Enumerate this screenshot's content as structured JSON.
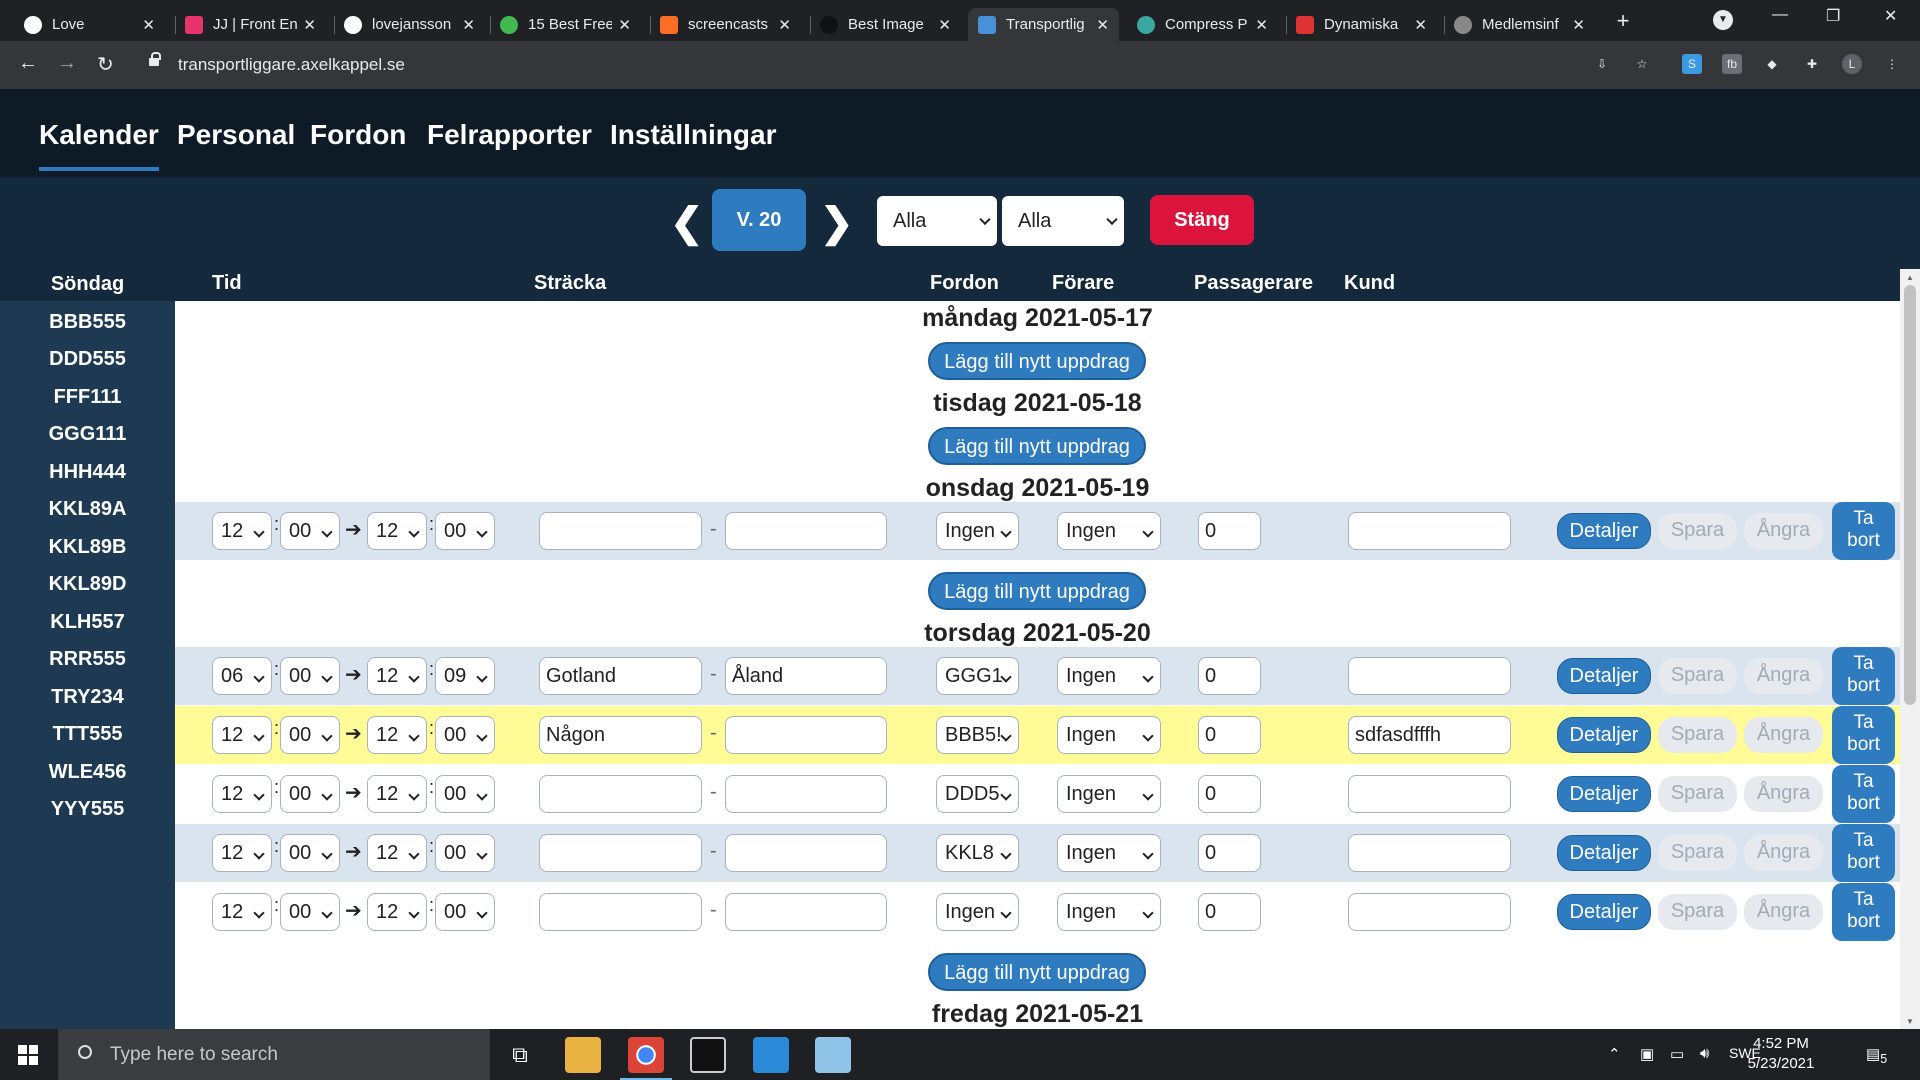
{
  "browser": {
    "tabs": [
      {
        "title": "Love",
        "color": "#ffffff"
      },
      {
        "title": "JJ | Front En",
        "color": "#e8336d"
      },
      {
        "title": "lovejansson",
        "color": "#ffffff"
      },
      {
        "title": "15 Best Free",
        "color": "#3fb950"
      },
      {
        "title": "screencasts",
        "color": "#fc6d26"
      },
      {
        "title": "Best Image",
        "color": "#111111"
      },
      {
        "title": "Transportlig",
        "color": "#4a90d9",
        "active": true
      },
      {
        "title": "Compress P",
        "color": "#3aa8a0"
      },
      {
        "title": "Dynamiska",
        "color": "#d33"
      },
      {
        "title": "Medlemsinf",
        "color": "#888888"
      }
    ],
    "url": "transportliggare.axelkappel.se"
  },
  "nav": {
    "items": [
      "Kalender",
      "Personal",
      "Fordon",
      "Felrapporter",
      "Inställningar"
    ]
  },
  "toolbar": {
    "week": "V. 20",
    "filter1": "Alla",
    "filter2": "Alla",
    "close": "Stäng"
  },
  "sidebar": {
    "title": "Söndag",
    "vehicles": [
      "BBB555",
      "DDD555",
      "FFF111",
      "GGG111",
      "HHH444",
      "KKL89A",
      "KKL89B",
      "KKL89D",
      "KLH557",
      "RRR555",
      "TRY234",
      "TTT555",
      "WLE456",
      "YYY555"
    ]
  },
  "columns": {
    "tid": "Tid",
    "stracka": "Sträcka",
    "fordon": "Fordon",
    "forare": "Förare",
    "passagerare": "Passagerare",
    "kund": "Kund"
  },
  "days": {
    "mon": "måndag 2021-05-17",
    "tue": "tisdag 2021-05-18",
    "wed": "onsdag 2021-05-19",
    "thu": "torsdag 2021-05-20",
    "fri": "fredag 2021-05-21"
  },
  "add_label": "Lägg till nytt uppdrag",
  "actions": {
    "details": "Detaljer",
    "save": "Spara",
    "undo": "Ångra",
    "delete_1": "Ta",
    "delete_2": "bort"
  },
  "rows": [
    {
      "h1": "12",
      "m1": "00",
      "h2": "12",
      "m2": "00",
      "from": "",
      "to": "",
      "vehicle": "Ingen",
      "driver": "Ingen",
      "pax": "0",
      "customer": ""
    },
    {
      "h1": "06",
      "m1": "00",
      "h2": "12",
      "m2": "09",
      "from": "Gotland",
      "to": "Åland",
      "vehicle": "GGG1",
      "driver": "Ingen",
      "pax": "0",
      "customer": ""
    },
    {
      "h1": "12",
      "m1": "00",
      "h2": "12",
      "m2": "00",
      "from": "Någon",
      "to": "",
      "vehicle": "BBB5!",
      "driver": "Ingen",
      "pax": "0",
      "customer": "sdfasdfffh"
    },
    {
      "h1": "12",
      "m1": "00",
      "h2": "12",
      "m2": "00",
      "from": "",
      "to": "",
      "vehicle": "DDD5",
      "driver": "Ingen",
      "pax": "0",
      "customer": ""
    },
    {
      "h1": "12",
      "m1": "00",
      "h2": "12",
      "m2": "00",
      "from": "",
      "to": "",
      "vehicle": "KKL8",
      "driver": "Ingen",
      "pax": "0",
      "customer": ""
    },
    {
      "h1": "12",
      "m1": "00",
      "h2": "12",
      "m2": "00",
      "from": "",
      "to": "",
      "vehicle": "Ingen",
      "driver": "Ingen",
      "pax": "0",
      "customer": ""
    }
  ],
  "taskbar": {
    "search_placeholder": "Type here to search",
    "lang": "SWE",
    "time": "4:52 PM",
    "date": "5/23/2021",
    "notif_count": "5"
  }
}
